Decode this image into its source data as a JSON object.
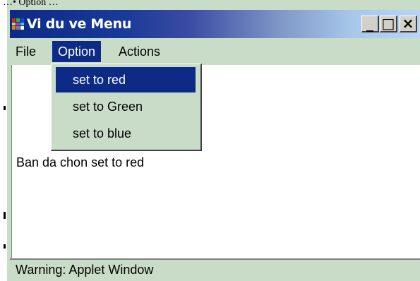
{
  "page": {
    "caption_fragment": "…• Option …"
  },
  "window": {
    "title": "Vi du ve Menu",
    "controls": {
      "minimize": "_",
      "maximize": "□",
      "close": "×"
    }
  },
  "menubar": {
    "items": [
      {
        "label": "File",
        "active": false
      },
      {
        "label": "Option",
        "active": true
      },
      {
        "label": "Actions",
        "active": false
      }
    ]
  },
  "dropdown": {
    "items": [
      {
        "label": "set to red",
        "selected": true
      },
      {
        "label": "set to Green",
        "selected": false
      },
      {
        "label": "set to blue",
        "selected": false
      }
    ]
  },
  "content": {
    "message": "Ban da chon set to red"
  },
  "statusbar": {
    "text": "Warning: Applet Window"
  },
  "colors": {
    "selection": "#0c2a86",
    "panel_background": "#c8dcc8",
    "titlebar_start": "#0c2a86",
    "titlebar_end": "#b8d4f2"
  },
  "icons": {
    "app": "app-icon",
    "minimize": "minimize-icon",
    "maximize": "maximize-icon",
    "close": "close-icon"
  }
}
